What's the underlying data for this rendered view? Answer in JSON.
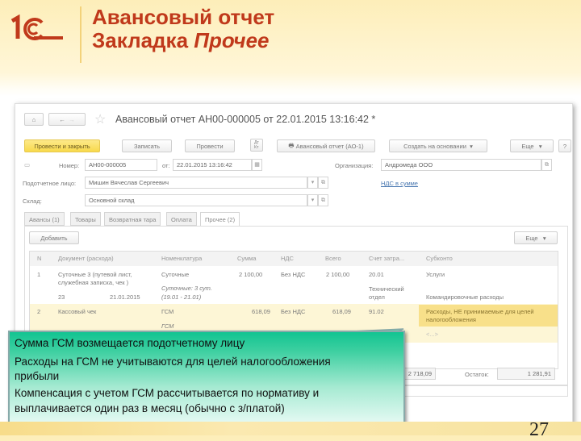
{
  "slide": {
    "title_line1": "Авансовый отчет",
    "title_line2_prefix": "Закладка ",
    "title_line2_italic": "Прочее",
    "page_number": "27",
    "logo_text": "1С"
  },
  "window": {
    "title": "Авансовый отчет АН00-000005 от 22.01.2015 13:16:42 *"
  },
  "toolbar": {
    "post_close": "Провести и закрыть",
    "save": "Записать",
    "post": "Провести",
    "print": "Авансовый отчет (АО-1)",
    "create_based": "Создать на основании",
    "more": "Еще",
    "help": "?"
  },
  "form": {
    "number_label": "Номер:",
    "number": "АН00-000005",
    "date_label": "от:",
    "date": "22.01.2015 13:16:42",
    "org_label": "Организация:",
    "org": "Андромеда ООО",
    "person_label": "Подотчетное лицо:",
    "person": "Мишин Вячеслав Сергеевич",
    "vat_link": "НДС в сумме",
    "warehouse_label": "Склад:",
    "warehouse": "Основной склад"
  },
  "tabs": [
    "Авансы (1)",
    "Товары",
    "Возвратная тара",
    "Оплата",
    "Прочее (2)"
  ],
  "table": {
    "add": "Добавить",
    "more": "Еще",
    "headers": [
      "N",
      "Документ (расхода)",
      "Номенклатура",
      "Сумма",
      "НДС",
      "Всего",
      "Счет затра...",
      "Субконто"
    ],
    "rows": [
      {
        "n": "1",
        "doc": "Суточные 3 (путевой лист,",
        "doc2": "служебная записка, чек )",
        "doc_num": "23",
        "doc_date": "21.01.2015",
        "item": "Суточные",
        "item2": "Суточные: 3 сут.",
        "item3": "(19.01 - 21.01)",
        "sum": "2 100,00",
        "vat": "Без НДС",
        "total": "2 100,00",
        "acc": "20.01",
        "acc2": "Технический",
        "acc3": "отдел",
        "sub1": "Услуги",
        "sub2": "Командировочные расходы"
      },
      {
        "n": "2",
        "doc": "Кассовый чек",
        "item": "ГСМ",
        "item2": "ГСМ",
        "sum": "618,09",
        "vat": "Без НДС",
        "total": "618,09",
        "acc": "91.02",
        "sub1": "Расходы, НЕ принимаемые для целей",
        "sub1b": "налогообложения",
        "sub2": "<...>"
      }
    ]
  },
  "footer": {
    "total": "2 718,09",
    "balance_label": "Остаток:",
    "balance": "1 281,91"
  },
  "callout": [
    "Сумма ГСМ возмещается подотчетному лицу",
    "Расходы на ГСМ не учитываются для целей налогообложения",
    "прибыли",
    "Компенсация с учетом ГСМ рассчитывается по нормативу и",
    "выплачивается один раз в месяц (обычно с з/платой)"
  ],
  "colors": {
    "title": "#c0391b",
    "accent_yellow": "#f8d94c",
    "callout": "#12c491"
  }
}
